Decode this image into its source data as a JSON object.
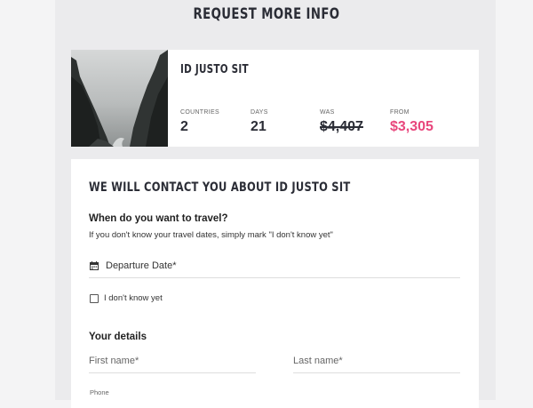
{
  "page": {
    "title": "REQUEST MORE INFO"
  },
  "trip": {
    "name": "ID JUSTO SIT",
    "stats": [
      {
        "label": "COUNTRIES",
        "value": "2"
      },
      {
        "label": "DAYS",
        "value": "21"
      },
      {
        "label": "WAS",
        "value": "$4,407"
      },
      {
        "label": "FROM",
        "value": "$3,305"
      }
    ]
  },
  "form": {
    "title": "WE WILL CONTACT YOU ABOUT ID JUSTO SIT",
    "travel_question": "When do you want to travel?",
    "travel_help": "If you don't know your travel dates, simply mark \"I don't know yet\"",
    "departure_date_placeholder": "Departure Date*",
    "dont_know_label": "I don't know yet",
    "details_title": "Your details",
    "first_name_placeholder": "First name*",
    "last_name_placeholder": "Last name*",
    "phone_label": "Phone"
  },
  "colors": {
    "accent_price": "#e8467c",
    "heading": "#2b2d36"
  },
  "icons": {
    "date_field": "calendar-icon"
  }
}
